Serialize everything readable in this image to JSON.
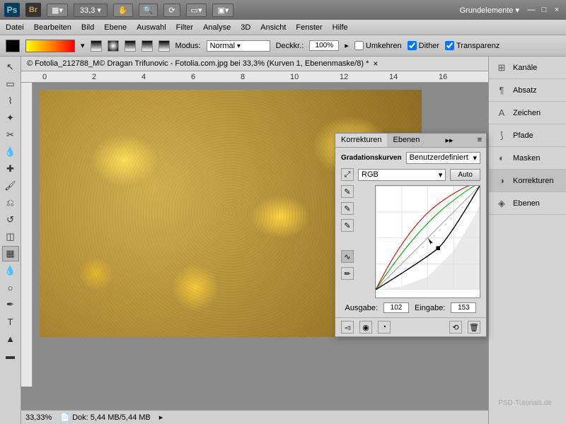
{
  "topbar": {
    "ps": "Ps",
    "br": "Br",
    "zoom": "33,3",
    "workspace": "Grundelemente ▾"
  },
  "menubar": [
    "Datei",
    "Bearbeiten",
    "Bild",
    "Ebene",
    "Auswahl",
    "Filter",
    "Analyse",
    "3D",
    "Ansicht",
    "Fenster",
    "Hilfe"
  ],
  "optbar": {
    "modus_label": "Modus:",
    "modus_value": "Normal",
    "opacity_label": "Deckkr.:",
    "opacity_value": "100%",
    "reverse": "Umkehren",
    "dither": "Dither",
    "transparency": "Transparenz"
  },
  "tab": {
    "title": "© Fotolia_212788_M© Dragan Trifunovic - Fotolia.com.jpg bei 33,3% (Kurven 1, Ebenenmaske/8) *"
  },
  "ruler_marks": [
    "0",
    "2",
    "4",
    "6",
    "8",
    "10",
    "12",
    "14",
    "16"
  ],
  "panels": [
    {
      "icon": "⊞",
      "label": "Kanäle"
    },
    {
      "icon": "¶",
      "label": "Absatz"
    },
    {
      "icon": "A",
      "label": "Zeichen"
    },
    {
      "icon": "⟆",
      "label": "Pfade"
    },
    {
      "icon": "◐",
      "label": "Masken"
    },
    {
      "icon": "◑",
      "label": "Korrekturen"
    },
    {
      "icon": "◈",
      "label": "Ebenen"
    }
  ],
  "curves": {
    "tab1": "Korrekturen",
    "tab2": "Ebenen",
    "title": "Gradationskurven",
    "preset": "Benutzerdefiniert",
    "channel": "RGB",
    "auto": "Auto",
    "output_label": "Ausgabe:",
    "output_value": "102",
    "input_label": "Eingabe:",
    "input_value": "153"
  },
  "statusbar": {
    "zoom": "33,33%",
    "doc": "Dok: 5,44 MB/5,44 MB"
  },
  "credit": "PSD-Tutorials.de"
}
